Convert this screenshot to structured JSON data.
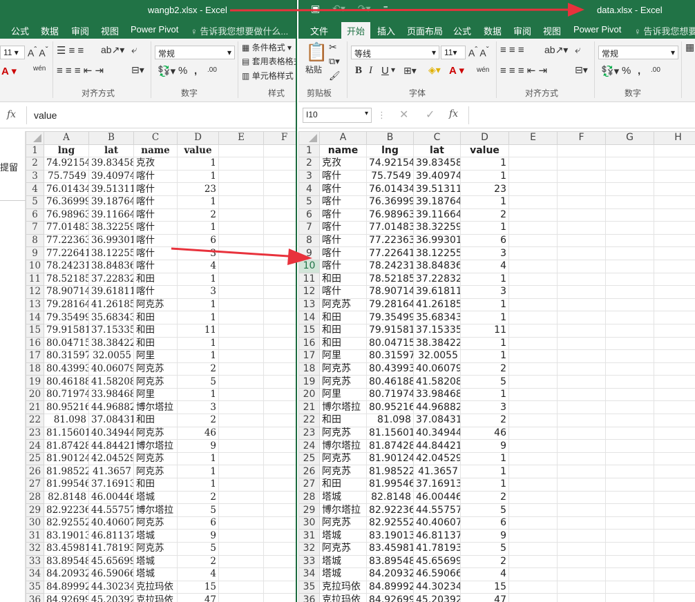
{
  "left": {
    "title": "wangb2.xlsx - Excel",
    "menu": [
      "公式",
      "数据",
      "审阅",
      "视图",
      "Power Pivot"
    ],
    "tell": "告诉我您想要做什么...",
    "ribbon": {
      "font_size": "11",
      "number_format": "常规",
      "cond_format": "条件格式",
      "table_format": "套用表格格式",
      "cell_style": "单元格样式",
      "grp_align": "对齐方式",
      "grp_number": "数字",
      "grp_style": "样式",
      "percent": "%",
      "comma": ",",
      "dec_inc": ".00",
      "wen": "wén"
    },
    "fx_value": "value",
    "side_text": "提留",
    "col_headers": [
      "A",
      "B",
      "C",
      "D",
      "E",
      "F"
    ],
    "rows": [
      [
        "lng",
        "lat",
        "name",
        "value"
      ],
      [
        "74.92154",
        "39.83458",
        "克孜",
        "1"
      ],
      [
        "75.7549",
        "39.40974",
        "喀什",
        "1"
      ],
      [
        "76.01434",
        "39.51311",
        "喀什",
        "23"
      ],
      [
        "76.36999",
        "39.18764",
        "喀什",
        "1"
      ],
      [
        "76.98963",
        "39.11664",
        "喀什",
        "2"
      ],
      [
        "77.01483",
        "38.32259",
        "喀什",
        "1"
      ],
      [
        "77.22363",
        "36.99301",
        "喀什",
        "6"
      ],
      [
        "77.22641",
        "38.12255",
        "喀什",
        "3"
      ],
      [
        "78.24231",
        "38.84836",
        "喀什",
        "4"
      ],
      [
        "78.52185",
        "37.22832",
        "和田",
        "1"
      ],
      [
        "78.90714",
        "39.61811",
        "喀什",
        "3"
      ],
      [
        "79.28164",
        "41.26185",
        "阿克苏",
        "1"
      ],
      [
        "79.35499",
        "35.68343",
        "和田",
        "1"
      ],
      [
        "79.91581",
        "37.15335",
        "和田",
        "11"
      ],
      [
        "80.04715",
        "38.38422",
        "和田",
        "1"
      ],
      [
        "80.31597",
        "32.0055",
        "阿里",
        "1"
      ],
      [
        "80.43993",
        "40.06079",
        "阿克苏",
        "2"
      ],
      [
        "80.46188",
        "41.58208",
        "阿克苏",
        "5"
      ],
      [
        "80.71974",
        "33.98468",
        "阿里",
        "1"
      ],
      [
        "80.95216",
        "44.96882",
        "博尔塔拉",
        "3"
      ],
      [
        "81.098",
        "37.08431",
        "和田",
        "2"
      ],
      [
        "81.15601",
        "40.34944",
        "阿克苏",
        "46"
      ],
      [
        "81.87428",
        "44.84421",
        "博尔塔拉",
        "9"
      ],
      [
        "81.90124",
        "42.04529",
        "阿克苏",
        "1"
      ],
      [
        "81.98522",
        "41.3657",
        "阿克苏",
        "1"
      ],
      [
        "81.99546",
        "37.16913",
        "和田",
        "1"
      ],
      [
        "82.8148",
        "46.00446",
        "塔城",
        "2"
      ],
      [
        "82.92236",
        "44.55757",
        "博尔塔拉",
        "5"
      ],
      [
        "82.92552",
        "40.40607",
        "阿克苏",
        "6"
      ],
      [
        "83.19013",
        "46.81137",
        "塔城",
        "9"
      ],
      [
        "83.45981",
        "41.78193",
        "阿克苏",
        "5"
      ],
      [
        "83.89548",
        "45.65699",
        "塔城",
        "2"
      ],
      [
        "84.20932",
        "46.59066",
        "塔城",
        "4"
      ],
      [
        "84.89992",
        "44.30234",
        "克拉玛依",
        "15"
      ],
      [
        "84.92699",
        "45.20392",
        "克拉玛依",
        "47"
      ]
    ]
  },
  "right": {
    "title": "data.xlsx - Excel",
    "menu": [
      "文件",
      "开始",
      "插入",
      "页面布局",
      "公式",
      "数据",
      "审阅",
      "视图",
      "Power Pivot"
    ],
    "active_tab": "开始",
    "tell": "告诉我您想要",
    "ribbon": {
      "paste": "粘贴",
      "font_name": "等线",
      "font_size": "11",
      "number_format": "常规",
      "grp_clipboard": "剪贴板",
      "grp_font": "字体",
      "grp_align": "对齐方式",
      "grp_number": "数字",
      "bold": "B",
      "italic": "I",
      "underline": "U",
      "percent": "%",
      "comma": ",",
      "wen": "wén"
    },
    "name_box": "I10",
    "selected_row": "10",
    "col_headers": [
      "A",
      "B",
      "C",
      "D",
      "E",
      "F",
      "G",
      "H"
    ],
    "rows": [
      [
        "name",
        "lng",
        "lat",
        "value"
      ],
      [
        "克孜",
        "74.92154",
        "39.83458",
        "1"
      ],
      [
        "喀什",
        "75.7549",
        "39.40974",
        "1"
      ],
      [
        "喀什",
        "76.01434",
        "39.51311",
        "23"
      ],
      [
        "喀什",
        "76.36999",
        "39.18764",
        "1"
      ],
      [
        "喀什",
        "76.98963",
        "39.11664",
        "2"
      ],
      [
        "喀什",
        "77.01483",
        "38.32259",
        "1"
      ],
      [
        "喀什",
        "77.22363",
        "36.99301",
        "6"
      ],
      [
        "喀什",
        "77.22641",
        "38.12255",
        "3"
      ],
      [
        "喀什",
        "78.24231",
        "38.84836",
        "4"
      ],
      [
        "和田",
        "78.52185",
        "37.22832",
        "1"
      ],
      [
        "喀什",
        "78.90714",
        "39.61811",
        "3"
      ],
      [
        "阿克苏",
        "79.28164",
        "41.26185",
        "1"
      ],
      [
        "和田",
        "79.35499",
        "35.68343",
        "1"
      ],
      [
        "和田",
        "79.91581",
        "37.15335",
        "11"
      ],
      [
        "和田",
        "80.04715",
        "38.38422",
        "1"
      ],
      [
        "阿里",
        "80.31597",
        "32.0055",
        "1"
      ],
      [
        "阿克苏",
        "80.43993",
        "40.06079",
        "2"
      ],
      [
        "阿克苏",
        "80.46188",
        "41.58208",
        "5"
      ],
      [
        "阿里",
        "80.71974",
        "33.98468",
        "1"
      ],
      [
        "博尔塔拉",
        "80.95216",
        "44.96882",
        "3"
      ],
      [
        "和田",
        "81.098",
        "37.08431",
        "2"
      ],
      [
        "阿克苏",
        "81.15601",
        "40.34944",
        "46"
      ],
      [
        "博尔塔拉",
        "81.87428",
        "44.84421",
        "9"
      ],
      [
        "阿克苏",
        "81.90124",
        "42.04529",
        "1"
      ],
      [
        "阿克苏",
        "81.98522",
        "41.3657",
        "1"
      ],
      [
        "和田",
        "81.99546",
        "37.16913",
        "1"
      ],
      [
        "塔城",
        "82.8148",
        "46.00446",
        "2"
      ],
      [
        "博尔塔拉",
        "82.92236",
        "44.55757",
        "5"
      ],
      [
        "阿克苏",
        "82.92552",
        "40.40607",
        "6"
      ],
      [
        "塔城",
        "83.19013",
        "46.81137",
        "9"
      ],
      [
        "阿克苏",
        "83.45981",
        "41.78193",
        "5"
      ],
      [
        "塔城",
        "83.89548",
        "45.65699",
        "2"
      ],
      [
        "塔城",
        "84.20932",
        "46.59066",
        "4"
      ],
      [
        "克拉玛依",
        "84.89992",
        "44.30234",
        "15"
      ],
      [
        "克拉玛依",
        "84.92699",
        "45.20392",
        "47"
      ]
    ]
  },
  "colors": {
    "excel_green": "#217346",
    "arrow_red": "#e8323c"
  }
}
